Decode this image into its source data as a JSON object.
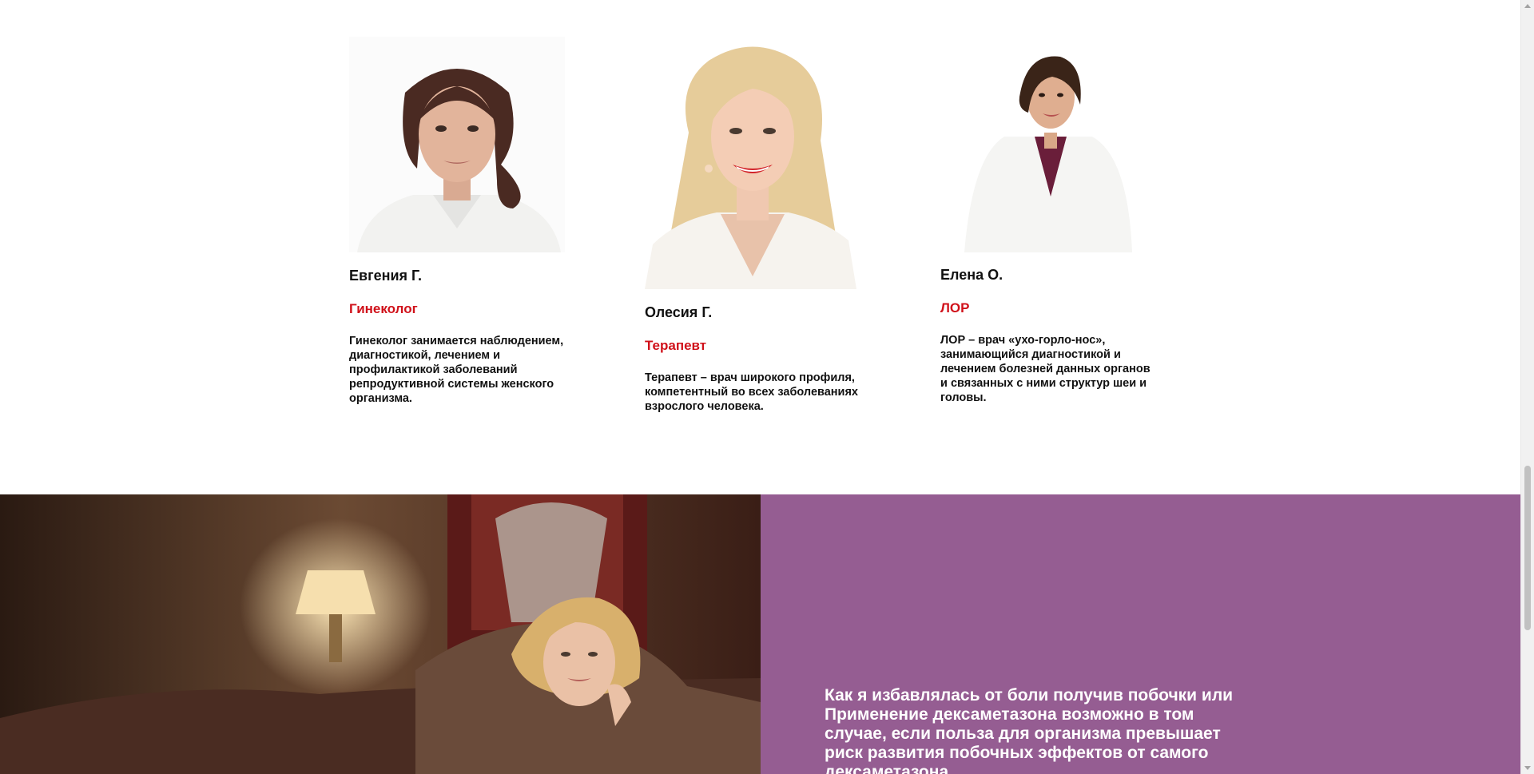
{
  "doctors": [
    {
      "name": "Евгения Г.",
      "role": "Гинеколог",
      "description": "Гинеколог занимается наблюдением, диагностикой, лечением и профилактикой заболеваний репродуктивной системы женского организма."
    },
    {
      "name": "Олесия Г.",
      "role": "Терапевт",
      "description": "Терапевт – врач широкого профиля, компетентный во всех заболеваниях взрослого человека."
    },
    {
      "name": "Елена О.",
      "role": "ЛОР",
      "description": "ЛОР – врач «ухо-горло-нос», занимающийся диагностикой и лечением болезней данных органов и связанных с ними структур шеи и головы."
    }
  ],
  "banner": {
    "text": "Как я избавлялась от боли получив побочки или Применение дексаметазона возможно в том случае, если польза для организма превышает риск развития побочных эффектов от самого дексаметазона."
  },
  "colors": {
    "role_accent": "#d0111a",
    "panel_purple": "#955d92",
    "text_dark": "#111111"
  }
}
